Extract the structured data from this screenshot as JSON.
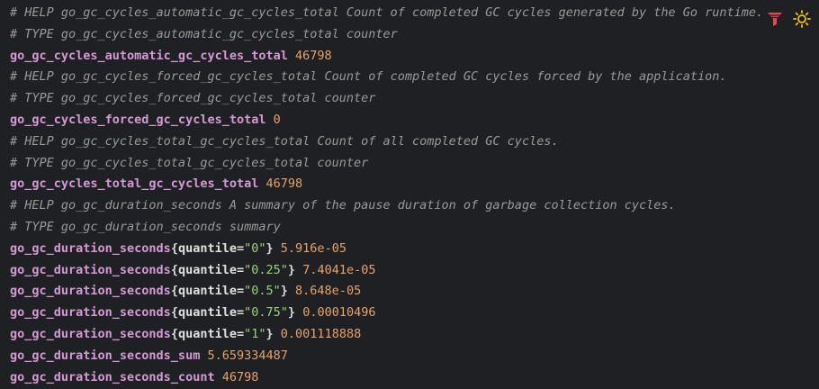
{
  "toolbar": {
    "filter_icon": "filter-icon",
    "theme_icon": "sun-icon",
    "filter_color": "#e5484d",
    "theme_color": "#f0c020"
  },
  "lines": [
    {
      "kind": "comment",
      "text": "# HELP go_gc_cycles_automatic_gc_cycles_total Count of completed GC cycles generated by the Go runtime."
    },
    {
      "kind": "comment",
      "text": "# TYPE go_gc_cycles_automatic_gc_cycles_total counter"
    },
    {
      "kind": "metric",
      "name": "go_gc_cycles_automatic_gc_cycles_total",
      "value": "46798"
    },
    {
      "kind": "comment",
      "text": "# HELP go_gc_cycles_forced_gc_cycles_total Count of completed GC cycles forced by the application."
    },
    {
      "kind": "comment",
      "text": "# TYPE go_gc_cycles_forced_gc_cycles_total counter"
    },
    {
      "kind": "metric",
      "name": "go_gc_cycles_forced_gc_cycles_total",
      "value": "0"
    },
    {
      "kind": "comment",
      "text": "# HELP go_gc_cycles_total_gc_cycles_total Count of all completed GC cycles."
    },
    {
      "kind": "comment",
      "text": "# TYPE go_gc_cycles_total_gc_cycles_total counter"
    },
    {
      "kind": "metric",
      "name": "go_gc_cycles_total_gc_cycles_total",
      "value": "46798"
    },
    {
      "kind": "comment",
      "text": "# HELP go_gc_duration_seconds A summary of the pause duration of garbage collection cycles."
    },
    {
      "kind": "comment",
      "text": "# TYPE go_gc_duration_seconds summary"
    },
    {
      "kind": "labeled",
      "name": "go_gc_duration_seconds",
      "label_key": "quantile",
      "label_value": "\"0\"",
      "value": "5.916e-05"
    },
    {
      "kind": "labeled",
      "name": "go_gc_duration_seconds",
      "label_key": "quantile",
      "label_value": "\"0.25\"",
      "value": "7.4041e-05"
    },
    {
      "kind": "labeled",
      "name": "go_gc_duration_seconds",
      "label_key": "quantile",
      "label_value": "\"0.5\"",
      "value": "8.648e-05"
    },
    {
      "kind": "labeled",
      "name": "go_gc_duration_seconds",
      "label_key": "quantile",
      "label_value": "\"0.75\"",
      "value": "0.00010496"
    },
    {
      "kind": "labeled",
      "name": "go_gc_duration_seconds",
      "label_key": "quantile",
      "label_value": "\"1\"",
      "value": "0.001118888"
    },
    {
      "kind": "metric",
      "name": "go_gc_duration_seconds_sum",
      "value": "5.659334487"
    },
    {
      "kind": "metric",
      "name": "go_gc_duration_seconds_count",
      "value": "46798"
    }
  ]
}
